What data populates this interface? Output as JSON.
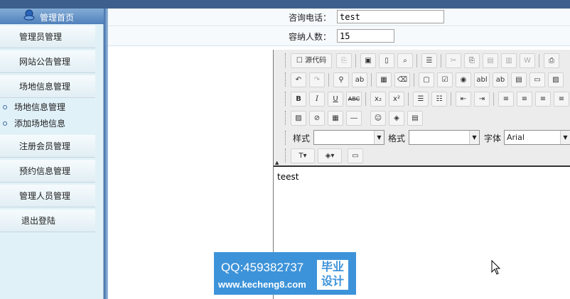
{
  "sidebar": {
    "header": "管理首页",
    "items": [
      {
        "label": "管理员管理"
      },
      {
        "label": "网站公告管理"
      },
      {
        "label": "场地信息管理"
      },
      {
        "label": "注册会员管理"
      },
      {
        "label": "预约信息管理"
      },
      {
        "label": "管理人员管理"
      },
      {
        "label": "退出登陆"
      }
    ],
    "subitems": [
      {
        "label": "场地信息管理"
      },
      {
        "label": "添加场地信息"
      }
    ]
  },
  "form": {
    "phone_label": "咨询电话：",
    "phone_value": "test",
    "capacity_label": "容纳人数：",
    "capacity_value": "15"
  },
  "editor": {
    "source_label": "源代码",
    "style_label": "样式",
    "format_label": "格式",
    "font_label": "字体",
    "font_value": "Arial",
    "content": "teest"
  },
  "watermark": {
    "qq": "QQ:459382737",
    "url": "www.kecheng8.com",
    "badge_line1": "毕业",
    "badge_line2": "设计"
  },
  "colors": {
    "sidebar_bg": "#e1f1f8",
    "header_blue": "#4f80bb",
    "watermark_blue": "#3d93d9"
  }
}
